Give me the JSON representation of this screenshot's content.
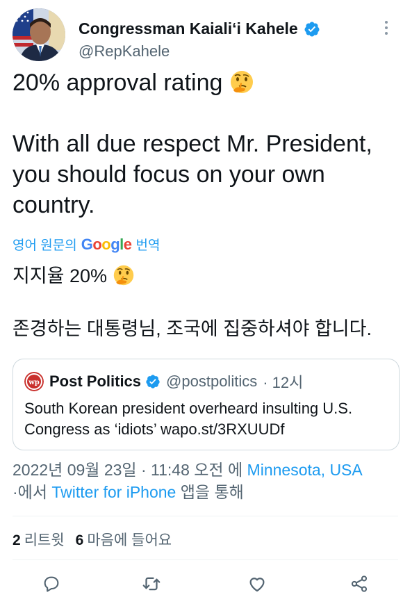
{
  "author": {
    "display_name": "Congressman Kaiali‘i Kahele",
    "handle": "@RepKahele"
  },
  "tweet": {
    "text": "20% approval rating",
    "text_rest": "\n\nWith all due respect Mr. President, you should focus on your own country."
  },
  "translation": {
    "prefix": "영어 원문의",
    "google": "Google",
    "suffix": "번역",
    "text_line1": "지지율 20%",
    "text_line2": "\n\n존경하는 대통령님, 조국에 집중하셔야 합니다."
  },
  "quote": {
    "name": "Post Politics",
    "handle": "@postpolitics",
    "time": "· 12시",
    "text": "South Korean president overheard insulting U.S. Congress as ‘idiots’ wapo.st/3RXUUDf"
  },
  "meta": {
    "datetime": "2022년 09월 23일 · 11:48 오전 에",
    "location": "Minnesota, USA",
    "from": "·에서",
    "client": "Twitter for iPhone",
    "via": "앱을 통해"
  },
  "stats": {
    "retweets_count": "2",
    "retweets_label": "리트윗",
    "likes_count": "6",
    "likes_label": "마음에 들어요"
  },
  "colors": {
    "accent": "#1d9bf0",
    "text": "#0f1419",
    "secondary": "#536471",
    "border": "#cfd9de"
  },
  "icons": {
    "reply": "reply-icon",
    "retweet": "retweet-icon",
    "like": "like-icon",
    "share": "share-icon"
  }
}
